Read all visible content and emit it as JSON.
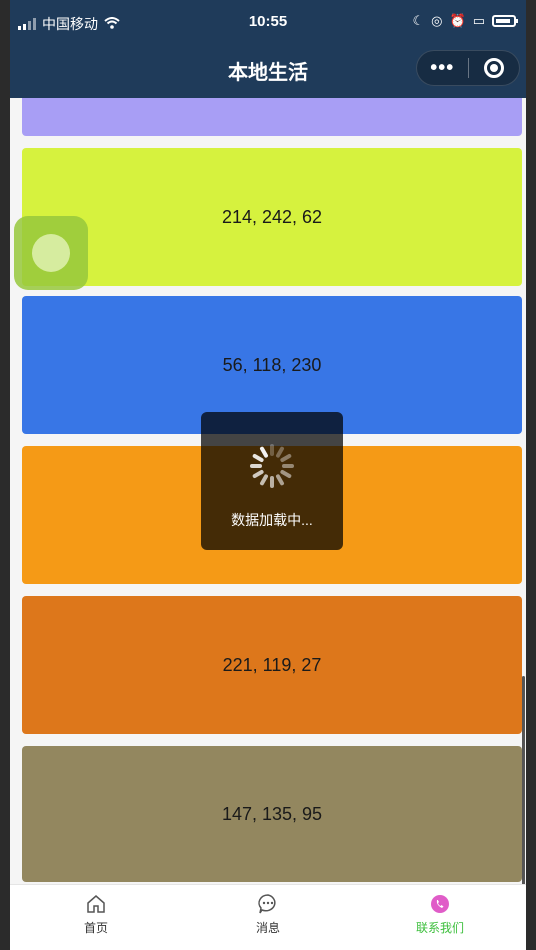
{
  "status_bar": {
    "carrier": "中国移动",
    "time": "10:55"
  },
  "nav": {
    "title": "本地生活",
    "more_glyph": "•••"
  },
  "cards": [
    {
      "label": "",
      "color": "#a89ef5"
    },
    {
      "label": "214, 242, 62",
      "color": "#d6f23e"
    },
    {
      "label": "56, 118, 230",
      "color": "#3876e6"
    },
    {
      "label": "",
      "color": "#f59a16"
    },
    {
      "label": "221, 119, 27",
      "color": "#dd771b"
    },
    {
      "label": "147, 135, 95",
      "color": "#93875f"
    }
  ],
  "loading_toast": {
    "text": "数据加载中..."
  },
  "tab_bar": {
    "tabs": [
      {
        "label": "首页",
        "icon": "home-icon",
        "active": false
      },
      {
        "label": "消息",
        "icon": "message-icon",
        "active": false
      },
      {
        "label": "联系我们",
        "icon": "phone-icon",
        "active": true
      }
    ]
  },
  "colors": {
    "nav_background": "#1f3b5a",
    "tab_active": "#3cbf3c"
  }
}
